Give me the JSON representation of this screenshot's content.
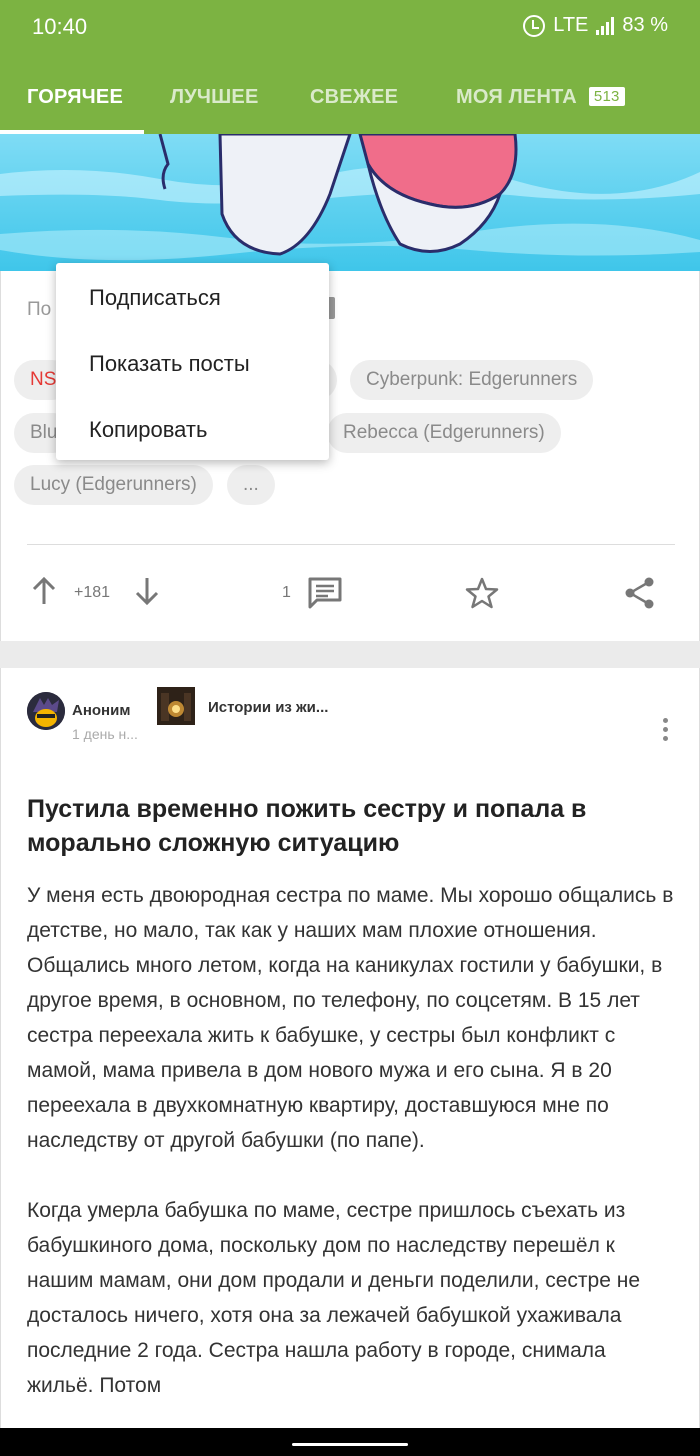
{
  "status_bar": {
    "time": "10:40",
    "network": "LTE",
    "battery": "83 %",
    "icons": [
      "alarm-icon",
      "signal-icon"
    ]
  },
  "tabs": [
    {
      "label": "ГОРЯЧЕЕ",
      "active": true
    },
    {
      "label": "ЛУЧШЕЕ",
      "active": false
    },
    {
      "label": "СВЕЖЕЕ",
      "active": false
    },
    {
      "label": "МОЯ ЛЕНТА",
      "badge": "513",
      "active": false
    }
  ],
  "post1": {
    "partial_text": "По",
    "tags": [
      "NS",
      "Cyberpunk: Edgerunners",
      "Blu",
      "Rebecca (Edgerunners)",
      "Lucy (Edgerunners)",
      "..."
    ],
    "votes": "+181",
    "comments": "1",
    "action_icons": [
      "arrow-up-icon",
      "arrow-down-icon",
      "comment-icon",
      "star-icon",
      "share-icon"
    ]
  },
  "menu": {
    "items": [
      "Подписаться",
      "Показать посты",
      "Копировать"
    ]
  },
  "post2": {
    "author": "Аноним",
    "time": "1 день н...",
    "community": "Истории из жи...",
    "title": "Пустила временно пожить сестру и попала в морально сложную ситуацию",
    "paragraphs": [
      "У меня есть двоюродная сестра по маме. Мы хорошо общались в детстве, но мало, так как у наших мам плохие отношения. Общались много летом, когда на каникулах гостили у бабушки, в другое время, в основном, по телефону, по соцсетям. В 15 лет сестра переехала жить к бабушке, у сестры был конфликт с мамой, мама привела в дом нового мужа и его сына. Я в 20 переехала в двухкомнатную квартиру, доставшуюся мне по наследству от другой бабушки (по папе).",
      "Когда умерла бабушка по маме, сестре пришлось съехать из бабушкиного дома, поскольку дом по наследству перешёл к нашим мамам, они дом продали и деньги поделили, сестре не досталось ничего, хотя она за лежачей бабушкой ухаживала последние 2 года. Сестра нашла работу в городе, снимала жильё. Потом"
    ]
  },
  "colors": {
    "accent": "#7cb342",
    "nsfw": "#e53935"
  }
}
